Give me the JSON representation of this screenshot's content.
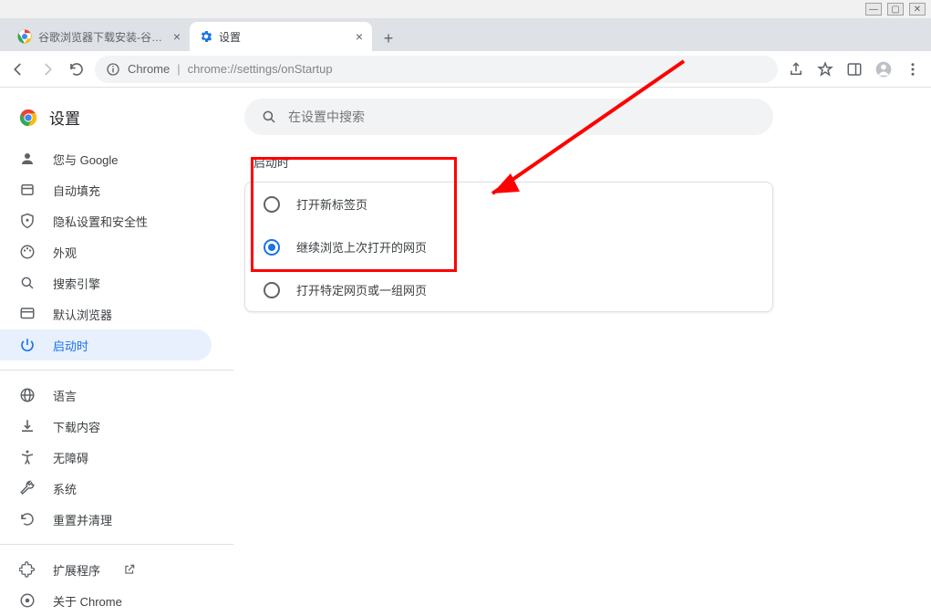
{
  "tabs": [
    {
      "title": "谷歌浏览器下载安装-谷歌浏览器"
    },
    {
      "title": "设置"
    }
  ],
  "omnibox": {
    "origin": "Chrome",
    "path": "chrome://settings/onStartup"
  },
  "settings_title": "设置",
  "search_placeholder": "在设置中搜索",
  "sidebar": {
    "items": [
      {
        "label": "您与 Google",
        "icon": "person"
      },
      {
        "label": "自动填充",
        "icon": "autofill"
      },
      {
        "label": "隐私设置和安全性",
        "icon": "shield"
      },
      {
        "label": "外观",
        "icon": "palette"
      },
      {
        "label": "搜索引擎",
        "icon": "search"
      },
      {
        "label": "默认浏览器",
        "icon": "browser"
      },
      {
        "label": "启动时",
        "icon": "power",
        "active": true
      }
    ],
    "items2": [
      {
        "label": "语言",
        "icon": "globe"
      },
      {
        "label": "下载内容",
        "icon": "download"
      },
      {
        "label": "无障碍",
        "icon": "accessibility"
      },
      {
        "label": "系统",
        "icon": "wrench"
      },
      {
        "label": "重置并清理",
        "icon": "reset"
      }
    ],
    "items3": [
      {
        "label": "扩展程序",
        "icon": "extension",
        "external": true
      },
      {
        "label": "关于 Chrome",
        "icon": "about"
      }
    ]
  },
  "section": {
    "title": "启动时",
    "options": [
      {
        "label": "打开新标签页",
        "selected": false
      },
      {
        "label": "继续浏览上次打开的网页",
        "selected": true
      },
      {
        "label": "打开特定网页或一组网页",
        "selected": false
      }
    ]
  }
}
